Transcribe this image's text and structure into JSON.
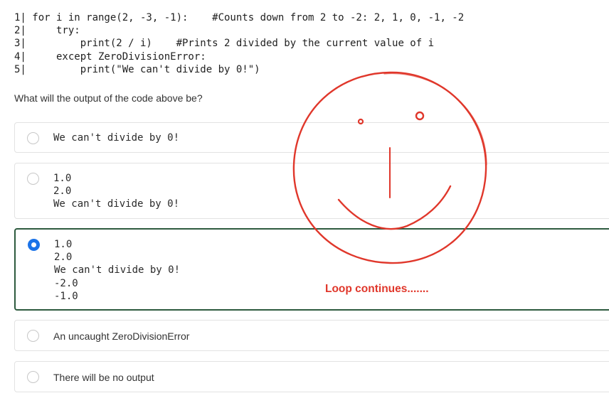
{
  "code": {
    "lines": [
      "1| for i in range(2, -3, -1):    #Counts down from 2 to -2: 2, 1, 0, -1, -2",
      "2|     try:",
      "3|         print(2 / i)    #Prints 2 divided by the current value of i",
      "4|     except ZeroDivisionError:",
      "5|         print(\"We can't divide by 0!\")"
    ]
  },
  "question": "What will the output of the code above be?",
  "options": [
    {
      "lines": [
        "We can't divide by 0!"
      ],
      "selected": false
    },
    {
      "lines": [
        "1.0",
        "2.0",
        "We can't divide by 0!"
      ],
      "selected": false
    },
    {
      "lines": [
        "1.0",
        "2.0",
        "We can't divide by 0!",
        "-2.0",
        "-1.0"
      ],
      "selected": true
    },
    {
      "text": "An uncaught ZeroDivisionError",
      "selected": false
    },
    {
      "text": "There will be no output",
      "selected": false
    }
  ],
  "annotation": {
    "label": "Loop continues.......",
    "color": "#e0372b"
  },
  "colors": {
    "selected_border": "#2d5a3f",
    "radio_checked": "#1b73e8"
  }
}
